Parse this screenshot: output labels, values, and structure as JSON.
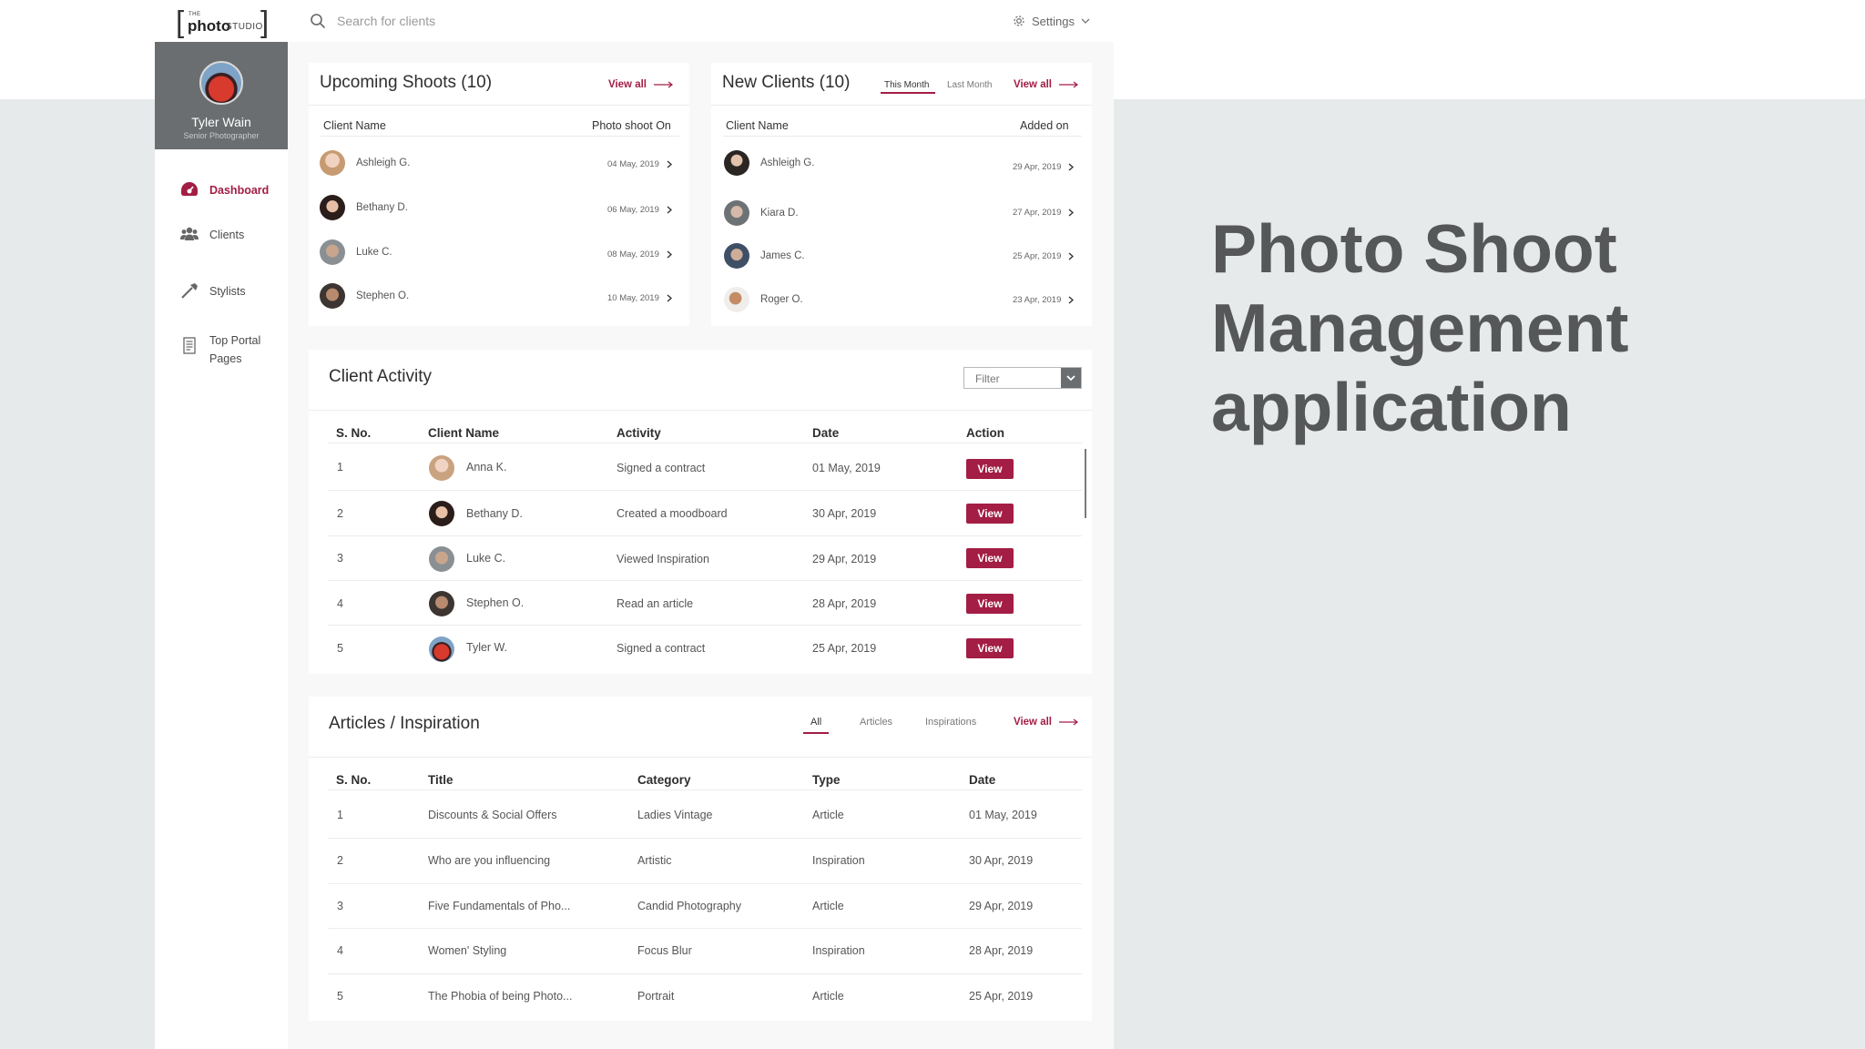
{
  "app": {
    "logo": {
      "small": "THE",
      "main": "photo",
      "sub": "STUDIO"
    },
    "search_placeholder": "Search for clients",
    "settings_label": "Settings"
  },
  "sidebar": {
    "profile": {
      "name": "Tyler Wain",
      "role": "Senior Photographer"
    },
    "items": [
      {
        "label": "Dashboard",
        "icon": "dashboard-icon",
        "active": true
      },
      {
        "label": "Clients",
        "icon": "clients-icon",
        "active": false
      },
      {
        "label": "Stylists",
        "icon": "stylists-icon",
        "active": false
      },
      {
        "label": "Top Portal Pages",
        "icon": "pages-icon",
        "active": false
      }
    ]
  },
  "upcoming": {
    "title": "Upcoming Shoots (10)",
    "view_all": "View all",
    "col_name": "Client Name",
    "col_date": "Photo shoot On",
    "rows": [
      {
        "name": "Ashleigh G.",
        "date": "04 May, 2019"
      },
      {
        "name": "Bethany D.",
        "date": "06 May, 2019"
      },
      {
        "name": "Luke C.",
        "date": "08 May, 2019"
      },
      {
        "name": "Stephen O.",
        "date": "10 May, 2019"
      }
    ]
  },
  "new_clients": {
    "title": "New Clients (10)",
    "tabs": [
      "This Month",
      "Last Month"
    ],
    "view_all": "View all",
    "col_name": "Client Name",
    "col_date": "Added on",
    "rows": [
      {
        "name": "Ashleigh G.",
        "date": "29 Apr, 2019"
      },
      {
        "name": "Kiara D.",
        "date": "27 Apr, 2019"
      },
      {
        "name": "James C.",
        "date": "25 Apr, 2019"
      },
      {
        "name": "Roger O.",
        "date": "23 Apr, 2019"
      }
    ]
  },
  "activity": {
    "title": "Client Activity",
    "filter": "Filter",
    "headers": [
      "S. No.",
      "Client Name",
      "Activity",
      "Date",
      "Action"
    ],
    "action_label": "View",
    "rows": [
      {
        "no": "1",
        "name": "Anna K.",
        "activity": "Signed a contract",
        "date": "01 May, 2019"
      },
      {
        "no": "2",
        "name": "Bethany D.",
        "activity": "Created a moodboard",
        "date": "30 Apr, 2019"
      },
      {
        "no": "3",
        "name": "Luke C.",
        "activity": "Viewed Inspiration",
        "date": "29 Apr, 2019"
      },
      {
        "no": "4",
        "name": "Stephen O.",
        "activity": "Read an article",
        "date": "28 Apr, 2019"
      },
      {
        "no": "5",
        "name": "Tyler W.",
        "activity": "Signed a contract",
        "date": "25 Apr, 2019"
      }
    ]
  },
  "articles": {
    "title": "Articles / Inspiration",
    "tabs": [
      "All",
      "Articles",
      "Inspirations"
    ],
    "view_all": "View all",
    "headers": [
      "S. No.",
      "Title",
      "Category",
      "Type",
      "Date"
    ],
    "rows": [
      {
        "no": "1",
        "title": "Discounts & Social Offers",
        "category": "Ladies Vintage",
        "type": "Article",
        "date": "01 May, 2019"
      },
      {
        "no": "2",
        "title": "Who are you influencing",
        "category": "Artistic",
        "type": "Inspiration",
        "date": "30 Apr, 2019"
      },
      {
        "no": "3",
        "title": "Five Fundamentals of Pho...",
        "category": "Candid Photography",
        "type": "Article",
        "date": "29 Apr, 2019"
      },
      {
        "no": "4",
        "title": "Women' Styling",
        "category": "Focus Blur",
        "type": "Inspiration",
        "date": "28 Apr, 2019"
      },
      {
        "no": "5",
        "title": "The Phobia of being Photo...",
        "category": "Portrait",
        "type": "Article",
        "date": "25 Apr, 2019"
      }
    ]
  },
  "hero": {
    "lines": [
      "Photo Shoot",
      "Management",
      "application"
    ]
  },
  "colors": {
    "accent": "#a31d44",
    "sidebar_profile": "#6b6e70",
    "band": "#e6eaeb",
    "hero_text": "#555759"
  }
}
